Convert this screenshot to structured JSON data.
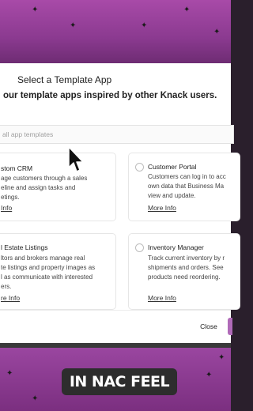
{
  "modal": {
    "title": "Select a Template App",
    "subtitle": "our template apps inspired by other Knack users.",
    "search_placeholder": "all app templates",
    "close_label": "Close"
  },
  "cards": [
    {
      "title": "stom CRM",
      "desc": [
        "age customers through a sales",
        "eline and assign tasks and",
        "etings."
      ],
      "more_info": "Info"
    },
    {
      "title": "Customer Portal",
      "desc": [
        "Customers can log in to acc",
        "own data that Business Ma",
        "view and update."
      ],
      "more_info": "More Info"
    },
    {
      "title": "l Estate Listings",
      "desc": [
        "ltors and brokers manage real",
        "te listings and property images as",
        "l as communicate with interested",
        "ers."
      ],
      "more_info": "re Info"
    },
    {
      "title": "Inventory Manager",
      "desc": [
        "Track current inventory by r",
        "shipments and orders. See",
        "products need reordering."
      ],
      "more_info": "More Info"
    }
  ],
  "caption": {
    "text": "IN NAC FEEL"
  },
  "colors": {
    "accent": "#9a46a0",
    "caption_bg": "#2d2d2d"
  }
}
